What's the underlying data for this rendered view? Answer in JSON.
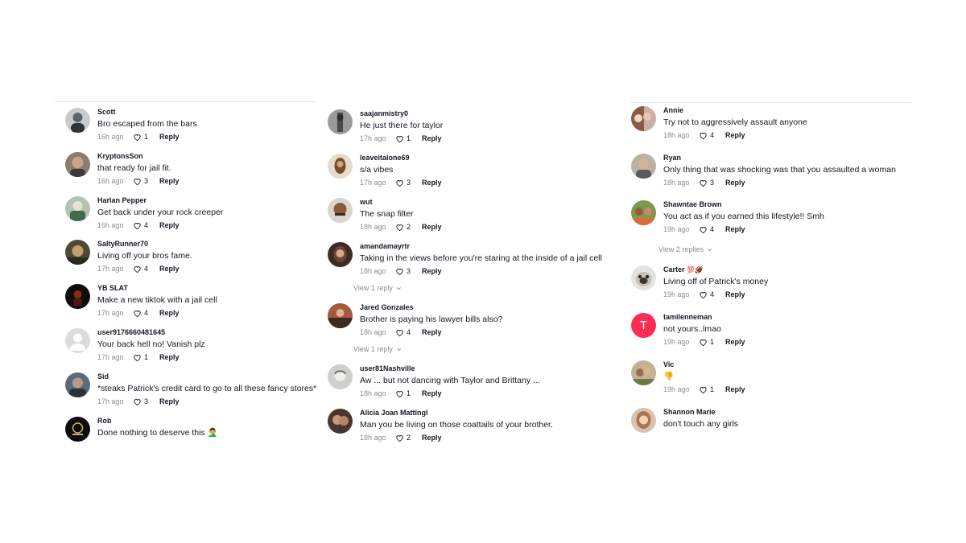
{
  "columns": [
    {
      "comments": [
        {
          "user": "Scott",
          "text": "Bro escaped from the bars",
          "time": "16h ago",
          "likes": "1",
          "reply": "Reply",
          "avatar_color": "#9aa0a6"
        },
        {
          "user": "KryptonsSon",
          "text": "that ready for jail fit.",
          "time": "16h ago",
          "likes": "3",
          "reply": "Reply",
          "avatar_color": "#7a6a5e"
        },
        {
          "user": "Harlan Pepper",
          "text": "Get back under your rock creeper",
          "time": "16h ago",
          "likes": "4",
          "reply": "Reply",
          "avatar_color": "#6f8f6e"
        },
        {
          "user": "SaltyRunner70",
          "text": "Living off your bros fame.",
          "time": "17h ago",
          "likes": "4",
          "reply": "Reply",
          "avatar_color": "#5b5a45"
        },
        {
          "user": "YB SLAT",
          "text": "Make a new tiktok with a jail cell",
          "time": "17h ago",
          "likes": "4",
          "reply": "Reply",
          "avatar_color": "#1e1a1a"
        },
        {
          "user": "user9176660481645",
          "text": "Your back hell no! Vanish plz",
          "time": "17h ago",
          "likes": "1",
          "reply": "Reply",
          "avatar_color": "#d9d9db"
        },
        {
          "user": "Sid",
          "text": "*steaks Patrick's credit card to go to all these fancy stores*",
          "time": "17h ago",
          "likes": "3",
          "reply": "Reply",
          "avatar_color": "#4f5b66"
        },
        {
          "user": "Rob",
          "text": "Done nothing to deserve this 🤦‍♂️",
          "time": "",
          "likes": "",
          "reply": "",
          "avatar_color": "#101010"
        }
      ]
    },
    {
      "comments": [
        {
          "user": "saajanmistry0",
          "text": "He just there for taylor",
          "time": "17h ago",
          "likes": "1",
          "reply": "Reply",
          "avatar_color": "#8c8c8c"
        },
        {
          "user": "leaveitalone69",
          "text": "s/a vibes",
          "time": "17h ago",
          "likes": "3",
          "reply": "Reply",
          "avatar_color": "#8a6a4a"
        },
        {
          "user": "wut",
          "text": "The snap filter",
          "time": "18h ago",
          "likes": "2",
          "reply": "Reply",
          "avatar_color": "#6e4f3e"
        },
        {
          "user": "amandamayrtr",
          "text": "Taking in the views before you're staring at the inside of a jail cell",
          "time": "18h ago",
          "likes": "3",
          "reply": "Reply",
          "avatar_color": "#5a4236"
        },
        {
          "user": "Jared Gonzales",
          "text": "Brother is paying his lawyer bills also?",
          "time": "18h ago",
          "likes": "4",
          "reply": "Reply",
          "avatar_color": "#9b4e3a"
        },
        {
          "user": "user81Nashville",
          "text": "Aw ... but not dancing with Taylor and Brittany ...",
          "time": "18h ago",
          "likes": "1",
          "reply": "Reply",
          "avatar_color": "#8d8d8d"
        },
        {
          "user": "Alicia Joan Mattingl",
          "text": "Man you be living on those coattails of your brother.",
          "time": "18h ago",
          "likes": "2",
          "reply": "Reply",
          "avatar_color": "#6b4a3f"
        }
      ],
      "view_replies": [
        "View 1 reply",
        "View 1 reply"
      ]
    },
    {
      "comments": [
        {
          "user": "Annie",
          "text": "Try not to aggressively assault anyone",
          "time": "18h ago",
          "likes": "4",
          "reply": "Reply",
          "avatar_color": "#a0715a"
        },
        {
          "user": "Ryan",
          "text": "Only thing that was shocking was that you assaulted a woman",
          "time": "18h ago",
          "likes": "3",
          "reply": "Reply",
          "avatar_color": "#7b7266"
        },
        {
          "user": "Shawntae Brown",
          "text": "You act as if you earned this lifestyle!! Smh",
          "time": "19h ago",
          "likes": "4",
          "reply": "Reply",
          "avatar_color": "#6e8a44"
        },
        {
          "user": "Carter",
          "text": "Living off of Patrick's money",
          "time": "19h ago",
          "likes": "4",
          "reply": "Reply",
          "avatar_color": "#8f8c86"
        },
        {
          "user": "tamilenneman",
          "text": "not yours..lmao",
          "time": "19h ago",
          "likes": "1",
          "reply": "Reply",
          "avatar_color": "#fe2c55",
          "avatar_letter": "T"
        },
        {
          "user": "Vic",
          "text": "👎",
          "time": "19h ago",
          "likes": "1",
          "reply": "Reply",
          "avatar_color": "#a08a6a"
        },
        {
          "user": "Shannon Marie",
          "text": "don't touch any girls",
          "time": "",
          "likes": "",
          "reply": "",
          "avatar_color": "#b98a6e"
        }
      ],
      "view_replies": [
        "View 2 replies"
      ],
      "carter_emojis": "💯🏈"
    }
  ],
  "colors": {
    "text": "#161823",
    "muted": "#8a8b91",
    "divider": "#e3e3e4"
  },
  "icons": {
    "like": "heart-outline-icon",
    "chevron": "chevron-down-icon"
  }
}
